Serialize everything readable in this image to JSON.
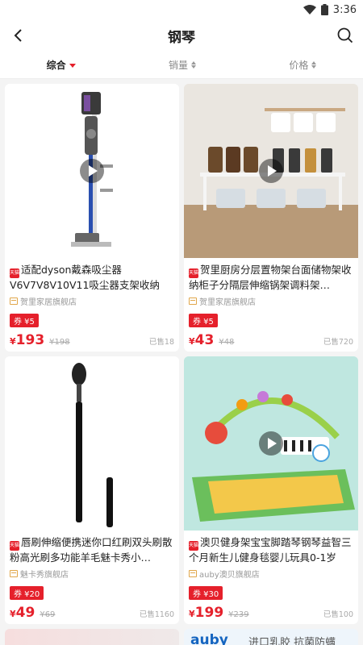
{
  "status": {
    "time": "3:36"
  },
  "nav": {
    "title": "钢琴"
  },
  "sort": [
    "综合",
    "销量",
    "价格"
  ],
  "products": [
    {
      "title": "适配dyson戴森吸尘器V6V7V8V10V11吸尘器支架收纳架…",
      "shop": "贺里家居旗舰店",
      "coupon": "券 ¥5",
      "price": "193",
      "original": "¥198",
      "sold": "已售18",
      "image": "vacuum-stand"
    },
    {
      "title": "贺里厨房分层置物架台面储物架收纳柜子分隔层伸缩锅架调料架…",
      "shop": "贺里家居旗舰店",
      "coupon": "券 ¥5",
      "price": "43",
      "original": "¥48",
      "sold": "已售720",
      "image": "kitchen-shelf"
    },
    {
      "title": "唇刷伸缩便携迷你口红刷双头刷散粉高光刷多功能羊毛魅卡秀小…",
      "shop": "魅卡秀旗舰店",
      "coupon": "券 ¥20",
      "price": "49",
      "original": "¥69",
      "sold": "已售1160",
      "image": "makeup-brush"
    },
    {
      "title": "澳贝健身架宝宝脚踏琴钢琴益智三个月新生儿健身毯婴儿玩具0-1岁",
      "shop": "auby澳贝旗舰店",
      "coupon": "券 ¥30",
      "price": "199",
      "original": "¥239",
      "sold": "已售100",
      "image": "baby-gym"
    }
  ],
  "bottom_banner": {
    "logo": "auby",
    "text": "进口乳胶 抗菌防螨"
  },
  "currency": "¥",
  "tmall_tag": "天猫",
  "colors": {
    "accent": "#e5202b",
    "background": "#f4f4f4"
  }
}
